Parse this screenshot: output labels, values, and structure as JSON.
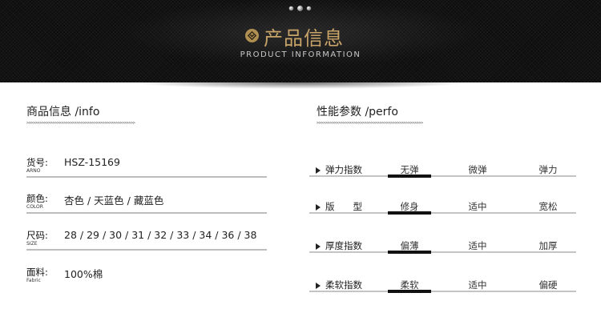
{
  "header": {
    "title": "产品信息",
    "subtitle": "PRODUCT INFORMATION",
    "icon": "chevron-down-diamond-icon",
    "accent_color": "#c9a468"
  },
  "info_section": {
    "heading": "商品信息 /info",
    "arrows": ">>>>>>>>>>>>>>>>>>>>>>>>>>>>>>>>>>>>>>>>>>>>>>>>>>",
    "rows": [
      {
        "label_cn": "货号:",
        "label_en": "ARNO",
        "value": "HSZ-15169"
      },
      {
        "label_cn": "颜色:",
        "label_en": "COLOR",
        "value": "杏色 / 天蓝色 / 藏蓝色"
      },
      {
        "label_cn": "尺码:",
        "label_en": "SIZE",
        "value": "28 / 29 / 30 / 31 / 32 / 33 / 34 / 36 / 38"
      },
      {
        "label_cn": "面料:",
        "label_en": "Fabric",
        "value": "100%棉"
      }
    ]
  },
  "perf_section": {
    "heading": "性能参数 /perfo",
    "arrows": ">>>>>>>>>>>>>>>>>>>>>>>>>>>>>>>>>>>>>>>>>>>>>>>>>",
    "rows": [
      {
        "name": "弹力指数",
        "options": [
          "无弹",
          "微弹",
          "弹力"
        ],
        "selected_index": 0
      },
      {
        "name": "版　　型",
        "options": [
          "修身",
          "适中",
          "宽松"
        ],
        "selected_index": 0
      },
      {
        "name": "厚度指数",
        "options": [
          "偏薄",
          "适中",
          "加厚"
        ],
        "selected_index": 0
      },
      {
        "name": "柔软指数",
        "options": [
          "柔软",
          "适中",
          "偏硬"
        ],
        "selected_index": 0
      }
    ]
  }
}
